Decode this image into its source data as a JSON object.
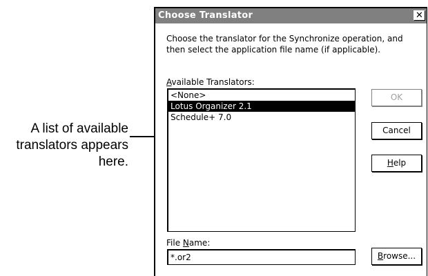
{
  "annotation": {
    "lines": [
      "A list of available",
      "translators appears",
      "here."
    ]
  },
  "dialog": {
    "title": "Choose Translator",
    "close_glyph": "✕",
    "instructions": "Choose the translator for the Synchronize operation, and then select the application file name (if applicable).",
    "available_label": {
      "prefix": "",
      "mnemonic": "A",
      "suffix": "vailable Translators:"
    },
    "translators": [
      {
        "label": "<None>",
        "selected": false
      },
      {
        "label": "Lotus Organizer 2.1",
        "selected": true
      },
      {
        "label": "Schedule+ 7.0",
        "selected": false
      }
    ],
    "file_label": {
      "prefix": "File ",
      "mnemonic": "N",
      "suffix": "ame:"
    },
    "file_name_value": "*.or2",
    "buttons": {
      "ok": {
        "label": "OK",
        "enabled": false
      },
      "cancel": {
        "label": "Cancel",
        "enabled": true
      },
      "help": {
        "prefix": "",
        "mnemonic": "H",
        "suffix": "elp"
      },
      "browse": {
        "prefix": "",
        "mnemonic": "B",
        "suffix": "rowse..."
      }
    }
  }
}
